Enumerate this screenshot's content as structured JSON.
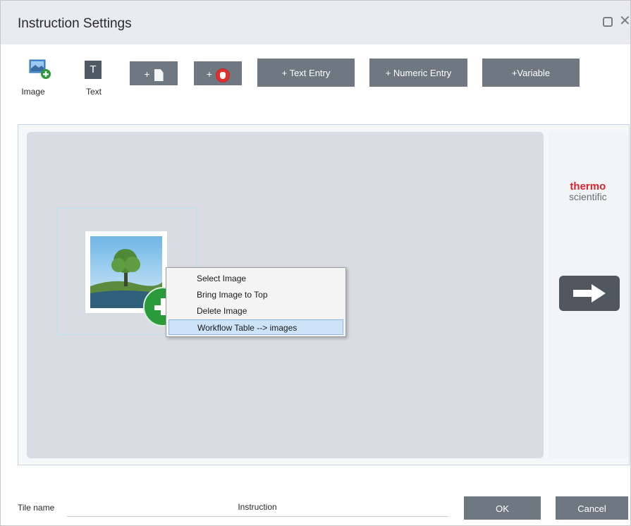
{
  "window": {
    "title": "Instruction Settings",
    "restore_icon": "restore-icon",
    "close_glyph": "✕"
  },
  "toolbar": {
    "image_label": "Image",
    "text_label": "Text",
    "text_icon_glyph": "T",
    "add_document_plus": "+",
    "add_stop_plus": "+",
    "text_entry_label": "+ Text Entry",
    "numeric_entry_label": "+ Numeric Entry",
    "variable_label": "+Variable"
  },
  "canvas": {
    "brand_line1": "thermo",
    "brand_line2": "scientific"
  },
  "context_menu": {
    "items": [
      {
        "label": "Select Image"
      },
      {
        "label": "Bring Image to Top"
      },
      {
        "label": "Delete Image"
      },
      {
        "label": "Workflow Table --> images",
        "highlighted": true
      }
    ]
  },
  "footer": {
    "tile_name_label": "Tile name",
    "tile_name_value": "Instruction",
    "ok_label": "OK",
    "cancel_label": "Cancel"
  },
  "colors": {
    "toolbar_button": "#6f7781",
    "canvas_bg": "#d9dde3",
    "brand_red": "#d6252c",
    "menu_highlight": "#cde3f7"
  }
}
